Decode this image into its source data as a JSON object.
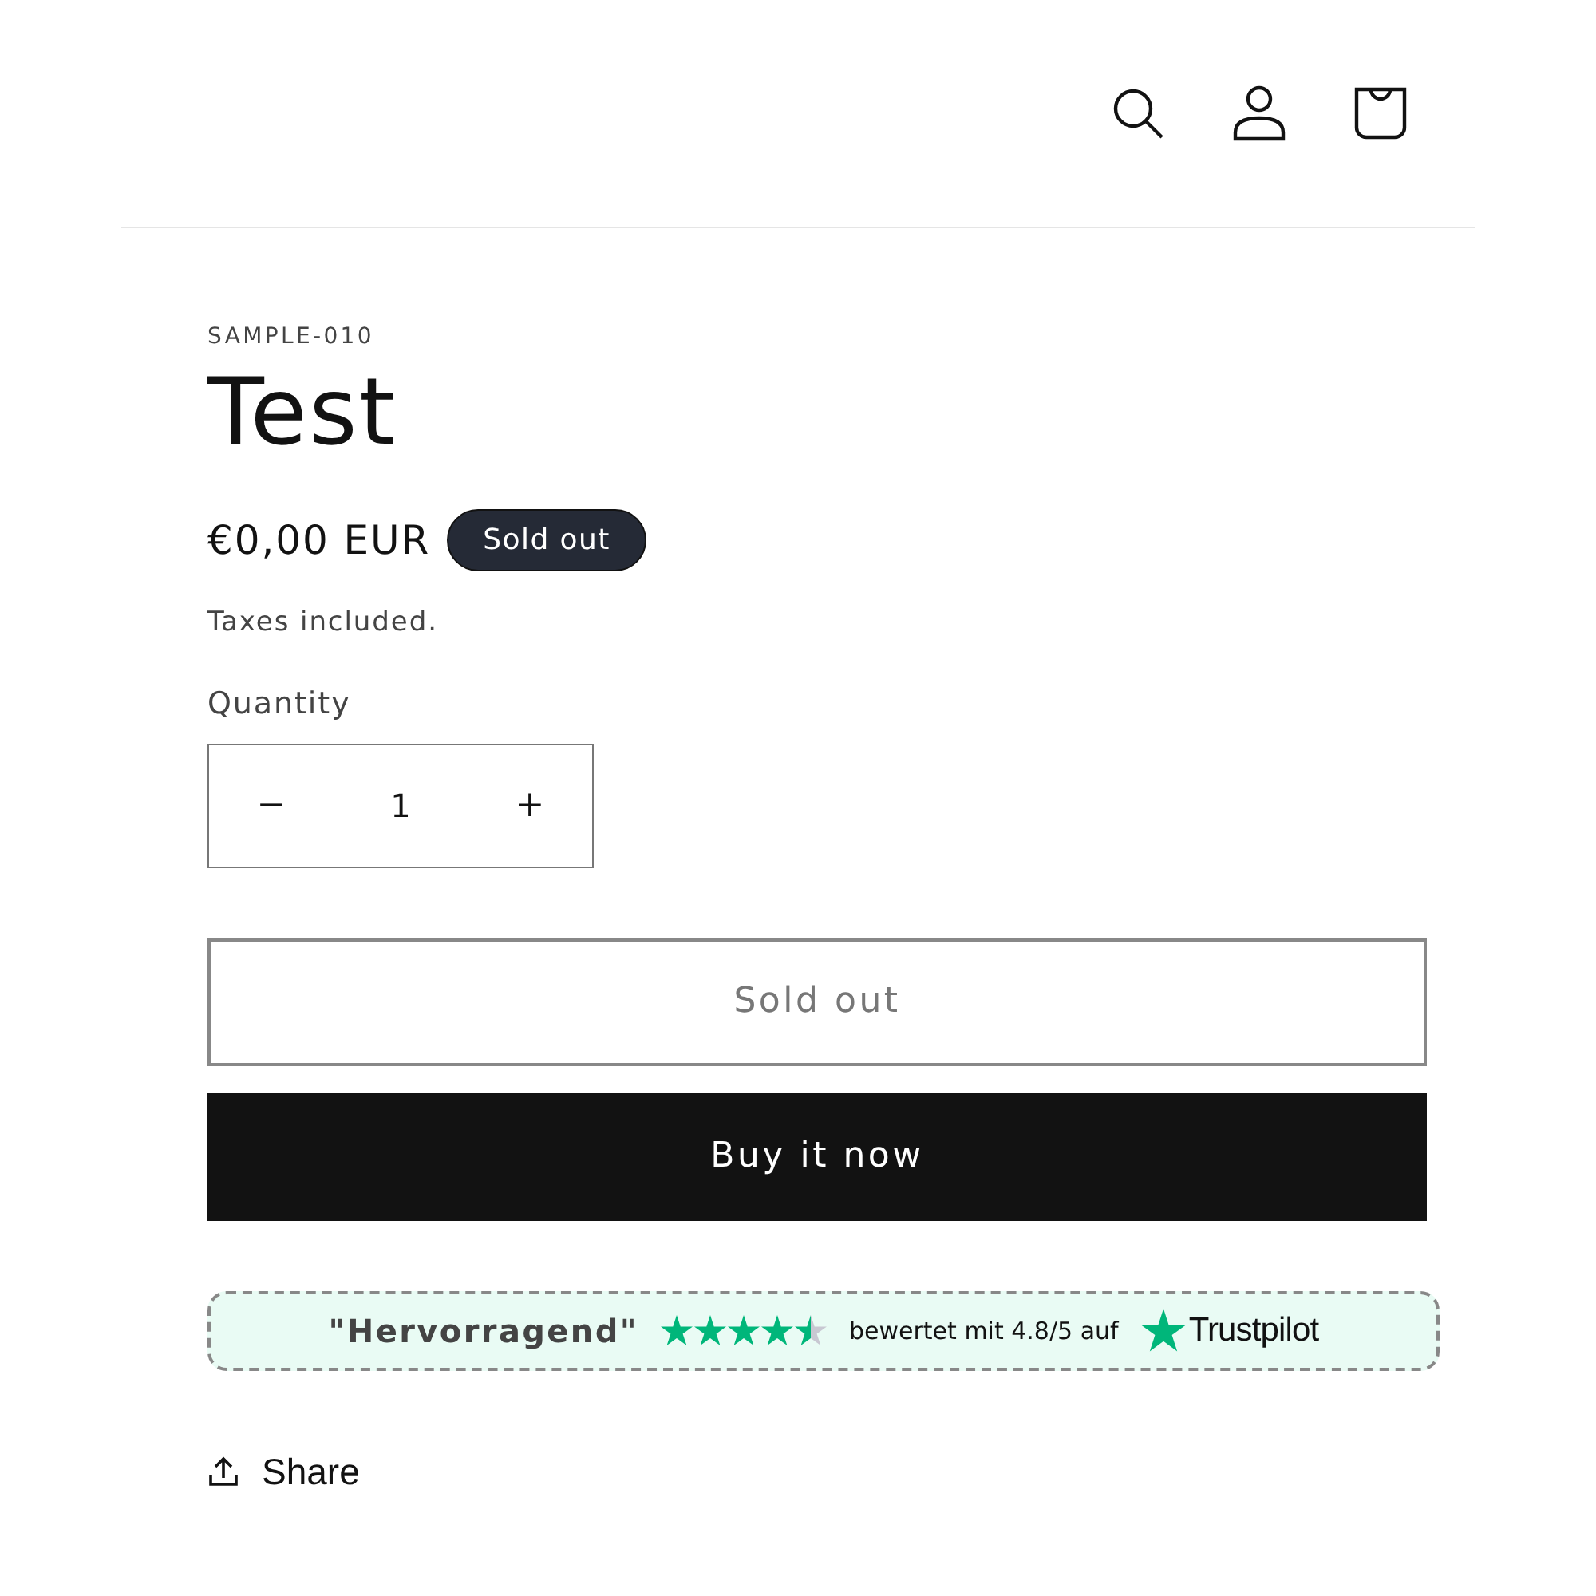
{
  "header": {
    "icons": [
      {
        "kind": "search"
      },
      {
        "kind": "account"
      },
      {
        "kind": "cart"
      }
    ]
  },
  "product": {
    "vendor": "SAMPLE-010",
    "title": "Test",
    "price": "€0,00 EUR",
    "badge": "Sold out",
    "tax_note": "Taxes included."
  },
  "quantity": {
    "label": "Quantity",
    "decrease": "−",
    "value": "1",
    "increase": "+"
  },
  "buttons": [
    {
      "label": "Sold out",
      "kind": "outline",
      "disabled": true
    },
    {
      "label": "Buy it now",
      "kind": "solid",
      "disabled": false
    }
  ],
  "trust_banner": {
    "headline": "\"Hervorragend\"",
    "stars": 4.5,
    "rating_text": "bewertet mit 4.8/5 auf",
    "brand": "Trustpilot"
  },
  "share": {
    "label": "Share"
  }
}
